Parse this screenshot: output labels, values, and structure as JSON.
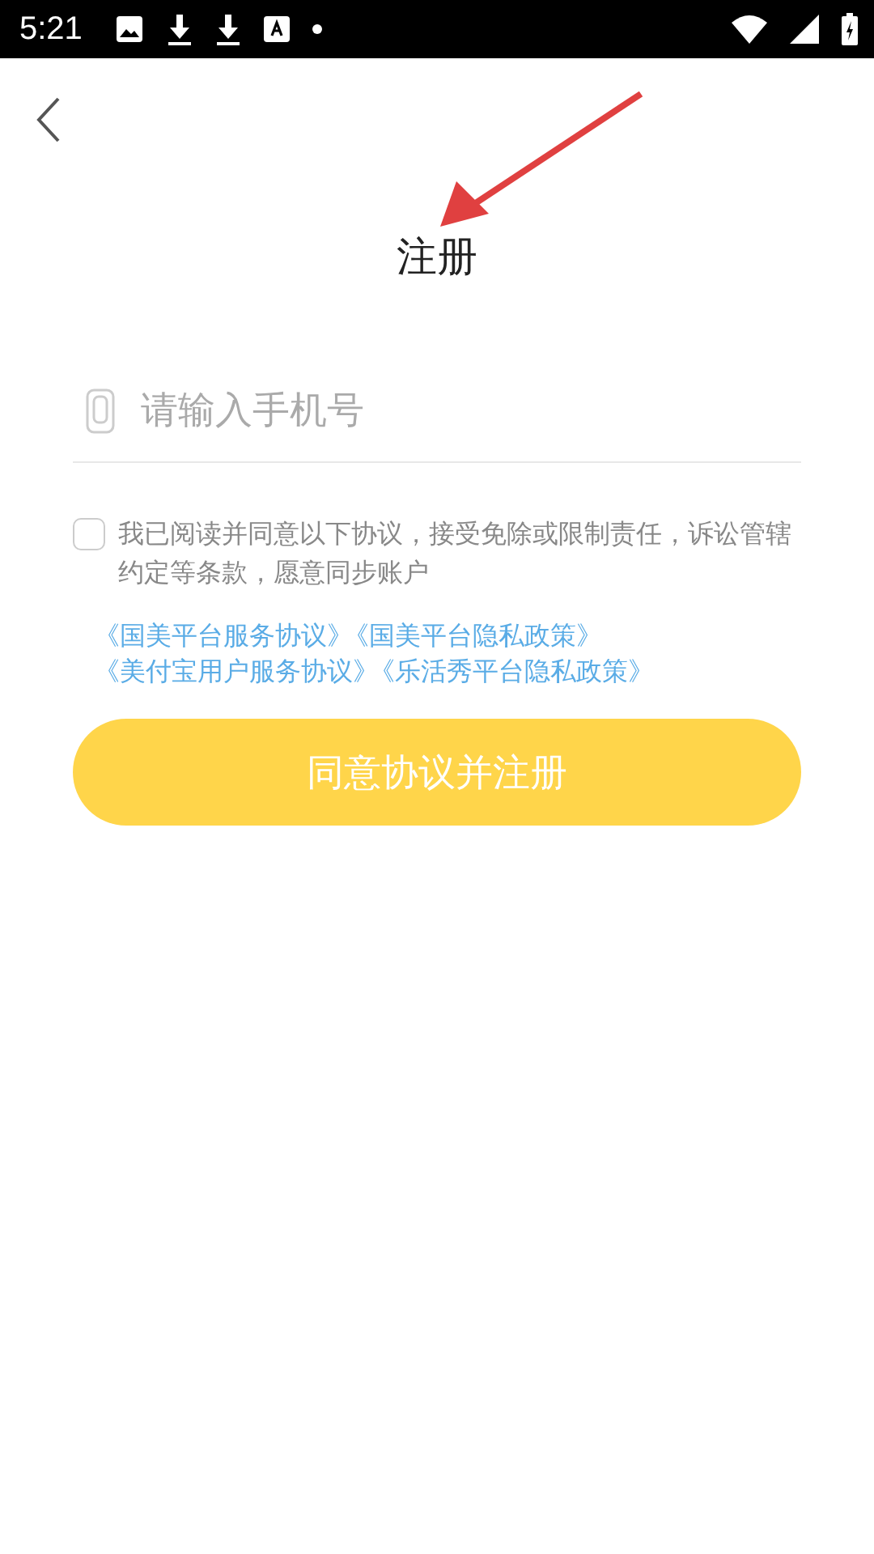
{
  "status_bar": {
    "time": "5:21"
  },
  "title": "注册",
  "phone_field": {
    "placeholder": "请输入手机号"
  },
  "agreement": {
    "checked": false,
    "text": "我已阅读并同意以下协议，接受免除或限制责任，诉讼管辖约定等条款，愿意同步账户"
  },
  "links": [
    [
      "《国美平台服务协议》",
      "《国美平台隐私政策》"
    ],
    [
      "《美付宝用户服务协议》",
      "《乐活秀平台隐私政策》"
    ]
  ],
  "submit_button": "同意协议并注册"
}
